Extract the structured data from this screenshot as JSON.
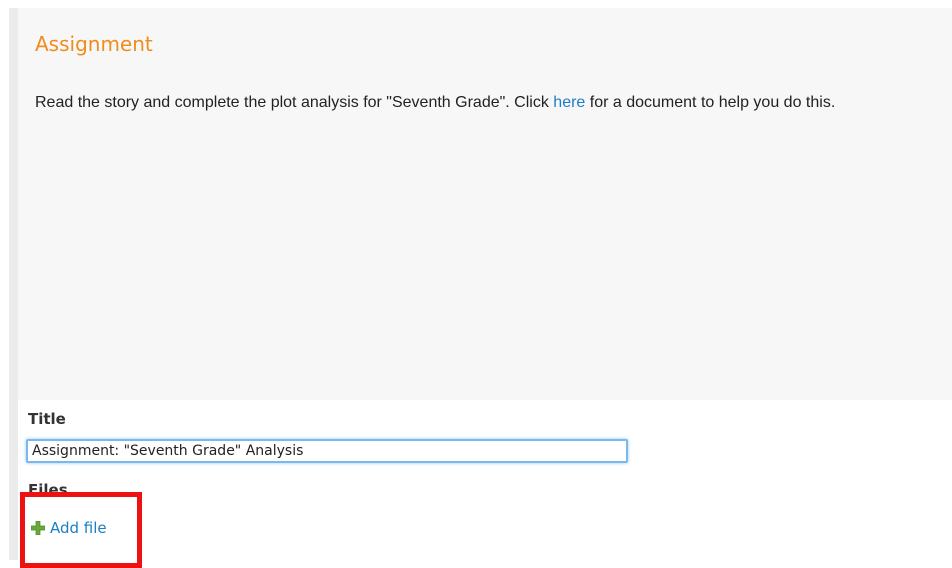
{
  "assignment": {
    "heading": "Assignment",
    "instructions_before_link": "Read the story and complete the plot analysis for \"Seventh Grade\".  Click ",
    "link_text": "here",
    "instructions_after_link": " for a document to help you do this."
  },
  "title_field": {
    "label": "Title",
    "value": "Assignment: \"Seventh Grade\" Analysis"
  },
  "files": {
    "label": "Files",
    "add_file_label": "Add file",
    "add_file_icon": "plus-icon"
  },
  "colors": {
    "heading": "#f08c1c",
    "link": "#1a7fc4",
    "plus_icon": "#6aa83a",
    "highlight": "#ee1111",
    "input_focus": "#7ab8ee"
  }
}
